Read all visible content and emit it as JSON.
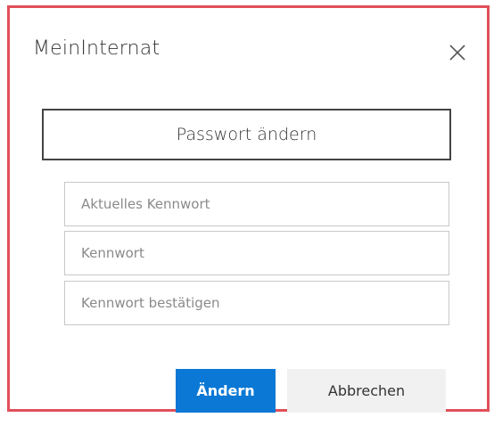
{
  "dialog": {
    "title": "MeinInternat",
    "close_icon": "close-icon",
    "section_heading": "Passwort ändern"
  },
  "form": {
    "current_password": {
      "placeholder": "Aktuelles Kennwort",
      "value": ""
    },
    "new_password": {
      "placeholder": "Kennwort",
      "value": ""
    },
    "confirm_password": {
      "placeholder": "Kennwort bestätigen",
      "value": ""
    }
  },
  "actions": {
    "submit_label": "Ändern",
    "cancel_label": "Abbrechen"
  },
  "colors": {
    "frame_border": "#e0505a",
    "primary": "#0a78d4",
    "secondary_bg": "#f1f1f1"
  }
}
